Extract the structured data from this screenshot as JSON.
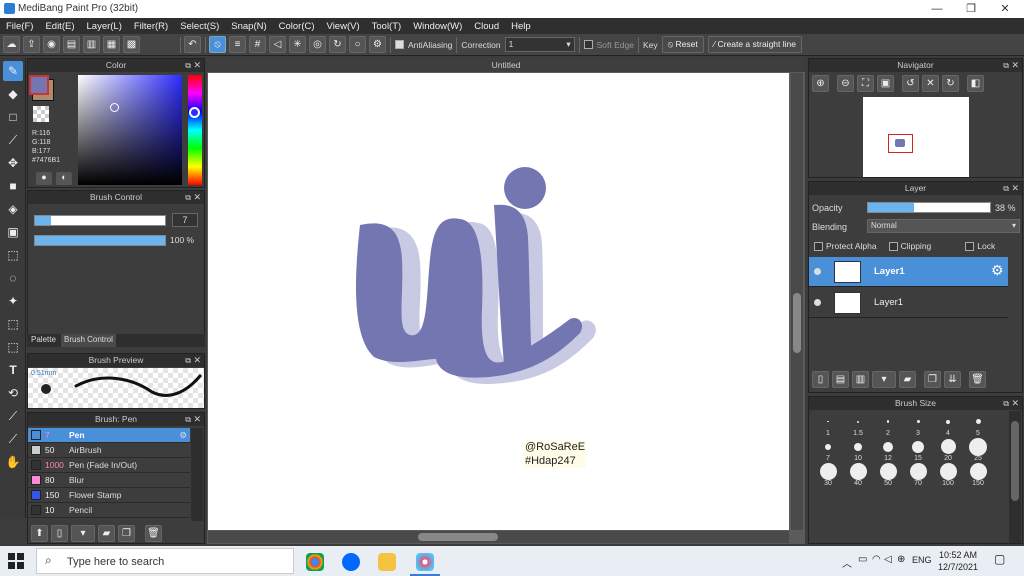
{
  "window": {
    "title": "MediBang Paint Pro (32bit)",
    "minimize": "—",
    "maximize": "❐",
    "close": "✕"
  },
  "menu": [
    "File(F)",
    "Edit(E)",
    "Layer(L)",
    "Filter(R)",
    "Select(S)",
    "Snap(N)",
    "Color(C)",
    "View(V)",
    "Tool(T)",
    "Window(W)",
    "Cloud",
    "Help"
  ],
  "toolbar": {
    "antialiasing": "AntiAliasing",
    "correction_label": "Correction",
    "correction_value": "1",
    "soft_edge": "Soft Edge",
    "key": "Key",
    "reset": "Reset",
    "straight_line": "Create a straight line"
  },
  "color_panel": {
    "title": "Color",
    "r": "R:116",
    "g": "G:118",
    "b": "B:177",
    "hex": "#7476B1",
    "primary": "#7476B1",
    "secondary": "#b08a6a"
  },
  "brush_control": {
    "title": "Brush Control",
    "size": "7",
    "opacity": "100 %"
  },
  "tabs": {
    "palette": "Palette",
    "brush_control": "Brush Control"
  },
  "brush_preview": {
    "title": "Brush Preview",
    "size": "0.51mm"
  },
  "brush_list": {
    "title": "Brush: Pen",
    "items": [
      {
        "size": "7",
        "name": "Pen",
        "color": "#4a90d9",
        "selected": true
      },
      {
        "size": "50",
        "name": "AirBrush",
        "color": "#cccccc",
        "selected": false
      },
      {
        "size": "1000",
        "name": "Pen (Fade In/Out)",
        "color": "#333333",
        "selected": false
      },
      {
        "size": "80",
        "name": "Blur",
        "color": "#ff88dd",
        "selected": false
      },
      {
        "size": "150",
        "name": "Flower Stamp",
        "color": "#3355ee",
        "selected": false
      },
      {
        "size": "10",
        "name": "Pencil",
        "color": "#333333",
        "selected": false
      }
    ]
  },
  "canvas": {
    "tab": "Untitled",
    "credit1": "@RoSaReE",
    "credit2": "#Hdap247",
    "stroke_color": "#7476B1",
    "shadow_color": "#c8c9e2"
  },
  "navigator": {
    "title": "Navigator"
  },
  "layer_panel": {
    "title": "Layer",
    "opacity_label": "Opacity",
    "opacity_value": "38 %",
    "opacity_fraction": 0.38,
    "blending_label": "Blending",
    "blending_value": "Normal",
    "protect_alpha": "Protect Alpha",
    "clipping": "Clipping",
    "lock": "Lock",
    "layers": [
      {
        "name": "Layer1",
        "selected": true
      },
      {
        "name": "Layer1",
        "selected": false
      }
    ]
  },
  "brush_size": {
    "title": "Brush Size",
    "sizes": [
      "1",
      "1.5",
      "2",
      "3",
      "4",
      "5",
      "7",
      "10",
      "12",
      "15",
      "20",
      "25",
      "30",
      "40",
      "50",
      "70",
      "100",
      "150"
    ]
  },
  "taskbar": {
    "search": "Type here to search",
    "time": "10:52 AM",
    "date": "12/7/2021",
    "lang": "ENG"
  }
}
